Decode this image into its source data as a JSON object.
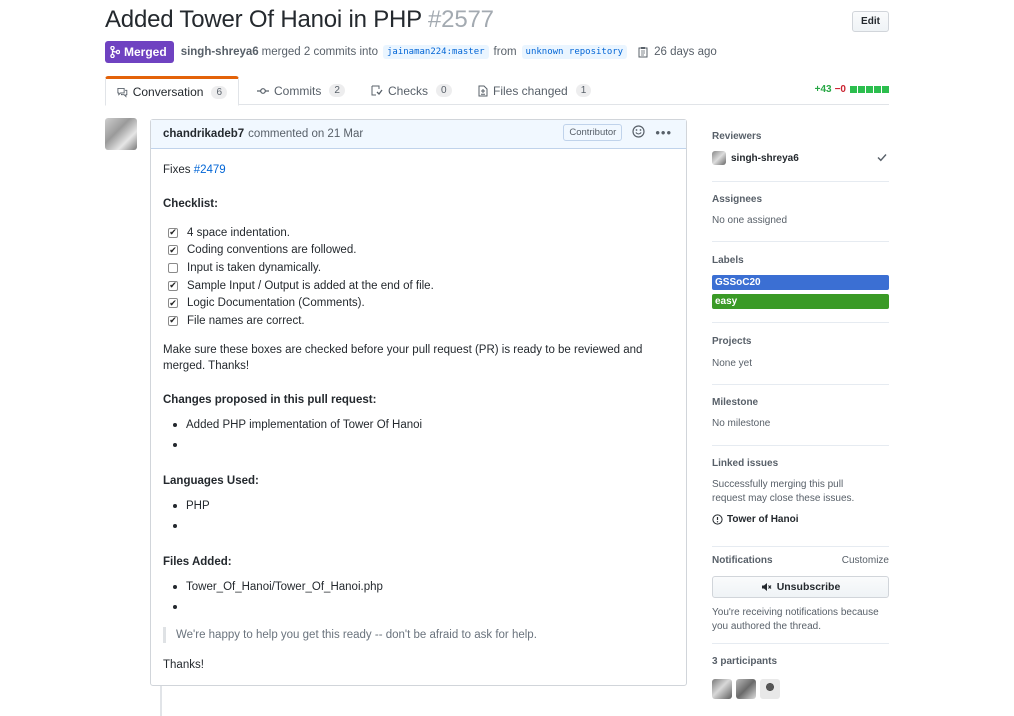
{
  "header": {
    "title": "Added Tower Of Hanoi in PHP",
    "number": "#2577",
    "edit_label": "Edit"
  },
  "meta": {
    "state": "Merged",
    "author": "singh-shreya6",
    "merged_text": "merged 2 commits into",
    "base_branch": "jainaman224:master",
    "from_text": "from",
    "head_branch": "unknown repository",
    "time_ago": "26 days ago"
  },
  "tabs": [
    {
      "label": "Conversation",
      "count": "6",
      "icon": "comment-discussion-icon"
    },
    {
      "label": "Commits",
      "count": "2",
      "icon": "git-commit-icon"
    },
    {
      "label": "Checks",
      "count": "0",
      "icon": "checklist-icon"
    },
    {
      "label": "Files changed",
      "count": "1",
      "icon": "file-diff-icon"
    }
  ],
  "diffstat": {
    "additions": "+43",
    "deletions": "−0"
  },
  "comment": {
    "author": "chandrikadeb7",
    "action": "commented on 21 Mar",
    "badge": "Contributor",
    "fixes_text": "Fixes",
    "fixes_link": "#2479",
    "checklist_heading": "Checklist:",
    "checklist": [
      {
        "text": "4 space indentation.",
        "checked": true
      },
      {
        "text": "Coding conventions are followed.",
        "checked": true
      },
      {
        "text": "Input is taken dynamically.",
        "checked": false
      },
      {
        "text": "Sample Input / Output is added at the end of file.",
        "checked": true
      },
      {
        "text": "Logic Documentation (Comments).",
        "checked": true
      },
      {
        "text": "File names are correct.",
        "checked": true
      }
    ],
    "make_sure": "Make sure these boxes are checked before your pull request (PR) is ready to be reviewed and merged. Thanks!",
    "changes_heading": "Changes proposed in this pull request:",
    "changes": [
      "Added PHP implementation of Tower Of Hanoi",
      ""
    ],
    "languages_heading": "Languages Used:",
    "languages": [
      "PHP",
      ""
    ],
    "files_heading": "Files Added:",
    "files": [
      "Tower_Of_Hanoi/Tower_Of_Hanoi.php",
      ""
    ],
    "quote": "We're happy to help you get this ready -- don't be afraid to ask for help.",
    "thanks": "Thanks!"
  },
  "sidebar": {
    "reviewers_heading": "Reviewers",
    "reviewer": "singh-shreya6",
    "assignees_heading": "Assignees",
    "assignees_value": "No one assigned",
    "labels_heading": "Labels",
    "labels": [
      {
        "name": "GSSoC20",
        "color": "#3b6fd3"
      },
      {
        "name": "easy",
        "color": "#3a9a26"
      }
    ],
    "projects_heading": "Projects",
    "projects_value": "None yet",
    "milestone_heading": "Milestone",
    "milestone_value": "No milestone",
    "linked_heading": "Linked issues",
    "linked_desc": "Successfully merging this pull request may close these issues.",
    "linked_issue": "Tower of Hanoi",
    "notifications_heading": "Notifications",
    "customize": "Customize",
    "unsubscribe": "Unsubscribe",
    "notif_reason": "You're receiving notifications because you authored the thread.",
    "participants_heading": "3 participants"
  },
  "colors": {
    "merged": "#6f42c1",
    "accent_tab": "#e36209",
    "link": "#0366d6",
    "add": "#28a745",
    "del": "#cb2431"
  }
}
